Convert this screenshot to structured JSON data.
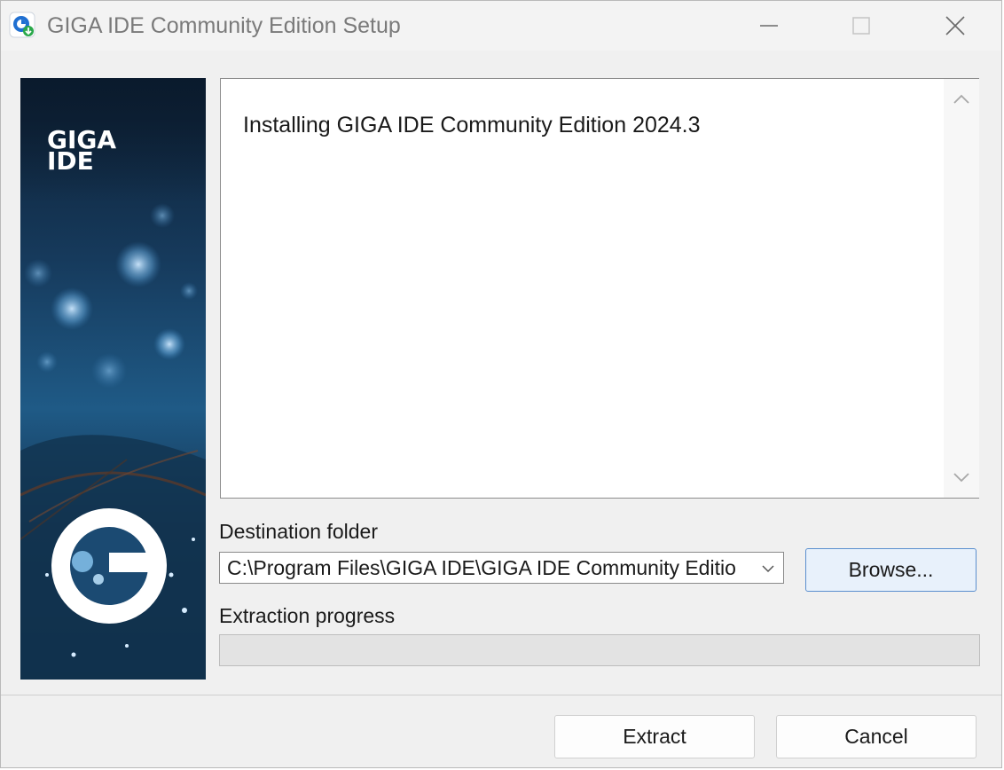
{
  "window": {
    "title": "GIGA IDE Community Edition Setup"
  },
  "titlebar_controls": {
    "icons": [
      "minimize-icon",
      "maximize-icon",
      "close-icon"
    ]
  },
  "banner": {
    "logo_text_line1": "GIGA",
    "logo_text_line2": "IDE"
  },
  "details": {
    "text": "Installing GIGA IDE Community Edition 2024.3"
  },
  "destination": {
    "label": "Destination folder",
    "value": "C:\\Program Files\\GIGA IDE\\GIGA IDE Community Editio",
    "browse_label": "Browse..."
  },
  "progress": {
    "label": "Extraction progress",
    "value": 0
  },
  "buttons": {
    "extract_label": "Extract",
    "cancel_label": "Cancel"
  },
  "colors": {
    "accent_border": "#5b8fcf",
    "browse_bg": "#e8f1fb",
    "progress_fill": "#06b025",
    "title_text": "#7a7a7a"
  }
}
